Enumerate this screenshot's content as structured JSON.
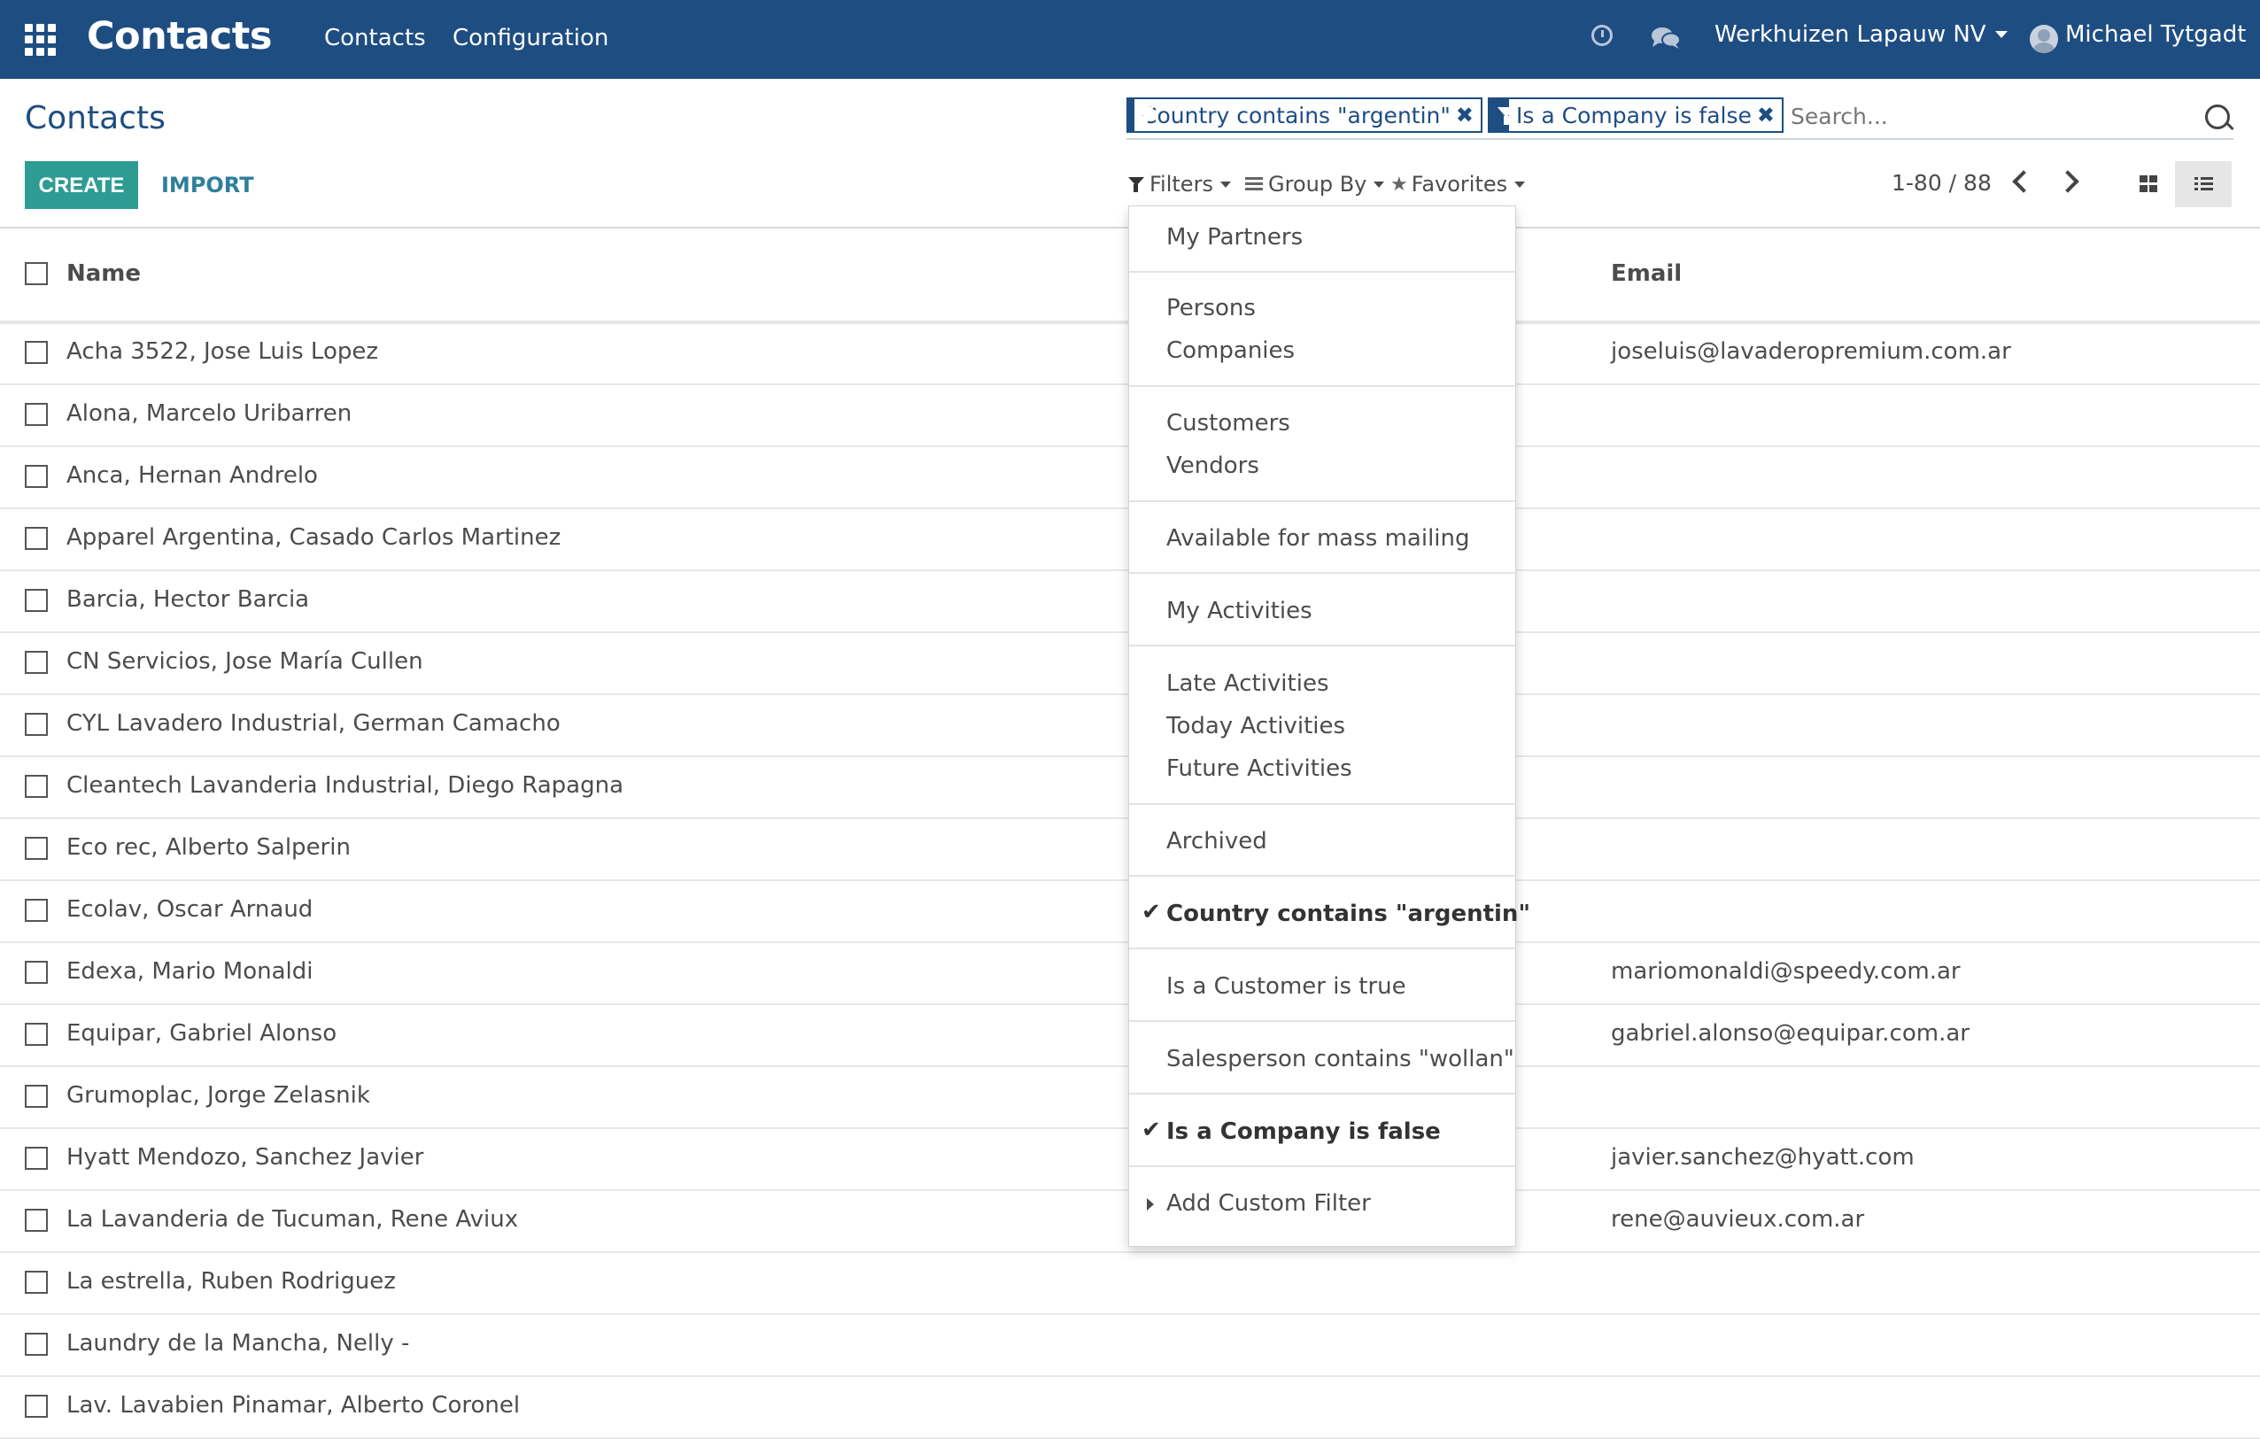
{
  "navbar": {
    "app_title": "Contacts",
    "menu": [
      "Contacts",
      "Configuration"
    ],
    "company": "Werkhuizen Lapauw NV",
    "user": "Michael Tytgadt"
  },
  "control_panel": {
    "breadcrumb": "Contacts",
    "create_label": "CREATE",
    "import_label": "IMPORT",
    "facets": [
      "Country contains \"argentin\"",
      "Is a Company is false"
    ],
    "facet_close": "✖",
    "search_placeholder": "Search...",
    "filters_label": "Filters",
    "groupby_label": "Group By",
    "favorites_label": "Favorites",
    "pager": "1-80 / 88"
  },
  "list": {
    "columns": {
      "name": "Name",
      "email": "Email"
    },
    "rows": [
      {
        "name": "Acha 3522, Jose Luis Lopez",
        "email": "joseluis@lavaderopremium.com.ar"
      },
      {
        "name": "Alona, Marcelo Uribarren",
        "email": ""
      },
      {
        "name": "Anca, Hernan Andrelo",
        "email": ""
      },
      {
        "name": "Apparel Argentina, Casado Carlos Martinez",
        "email": ""
      },
      {
        "name": "Barcia, Hector Barcia",
        "email": ""
      },
      {
        "name": "CN Servicios, Jose María Cullen",
        "email": ""
      },
      {
        "name": "CYL Lavadero Industrial, German Camacho",
        "email": ""
      },
      {
        "name": "Cleantech Lavanderia Industrial, Diego Rapagna",
        "email": ""
      },
      {
        "name": "Eco rec, Alberto Salperin",
        "email": ""
      },
      {
        "name": "Ecolav, Oscar Arnaud",
        "email": ""
      },
      {
        "name": "Edexa, Mario Monaldi",
        "email": "mariomonaldi@speedy.com.ar"
      },
      {
        "name": "Equipar, Gabriel Alonso",
        "email": "gabriel.alonso@equipar.com.ar"
      },
      {
        "name": "Grumoplac, Jorge Zelasnik",
        "email": ""
      },
      {
        "name": "Hyatt Mendozo, Sanchez Javier",
        "email": "javier.sanchez@hyatt.com"
      },
      {
        "name": "La Lavanderia de Tucuman, Rene Aviux",
        "email": "rene@auvieux.com.ar"
      },
      {
        "name": "La estrella, Ruben Rodriguez",
        "email": ""
      },
      {
        "name": "Laundry de la Mancha, Nelly -",
        "email": ""
      },
      {
        "name": "Lav. Lavabien Pinamar, Alberto Coronel",
        "email": ""
      }
    ]
  },
  "filters_menu": {
    "groups": [
      [
        "My Partners"
      ],
      [
        "Persons",
        "Companies"
      ],
      [
        "Customers",
        "Vendors"
      ],
      [
        "Available for mass mailing"
      ],
      [
        "My Activities"
      ],
      [
        "Late Activities",
        "Today Activities",
        "Future Activities"
      ],
      [
        "Archived"
      ],
      [
        "Country contains \"argentin\""
      ],
      [
        "Is a Customer is true"
      ],
      [
        "Salesperson contains \"wollan\""
      ],
      [
        "Is a Company is false"
      ],
      [
        "Add Custom Filter"
      ]
    ],
    "checked": [
      "Country contains \"argentin\"",
      "Is a Company is false"
    ],
    "checkmark": "✔"
  },
  "colors": {
    "navbar": "#1e4d82",
    "primary_button": "#2e9c93",
    "link": "#2e7f9c"
  }
}
